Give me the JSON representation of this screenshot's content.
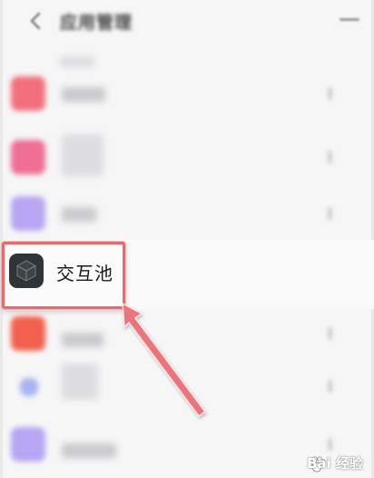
{
  "header": {
    "title": "应用管理",
    "back_icon": "chevron-left-icon",
    "menu_icon": "menu-icon"
  },
  "apps": [
    {
      "name": "",
      "icon_color": "#f2707e",
      "label_width": 48
    },
    {
      "name": "",
      "icon_color": "#ef6f95",
      "label_width": 0
    },
    {
      "name": "",
      "icon_color": "#b9a6f2",
      "label_width": 38
    },
    {
      "name": "交互池",
      "icon_color": "#2f3437",
      "highlighted": true
    },
    {
      "name": "",
      "icon_color": "#f2604e",
      "label_width": 46
    },
    {
      "name": "",
      "icon_color": "#a9b4f0",
      "label_width": 0
    },
    {
      "name": "",
      "icon_color": "#b7a6f3",
      "label_width": 60
    }
  ],
  "annotation": {
    "arrow_color": "#e8767c",
    "box_color": "#e66a6f"
  },
  "watermark": {
    "text": "Bai 经验"
  }
}
